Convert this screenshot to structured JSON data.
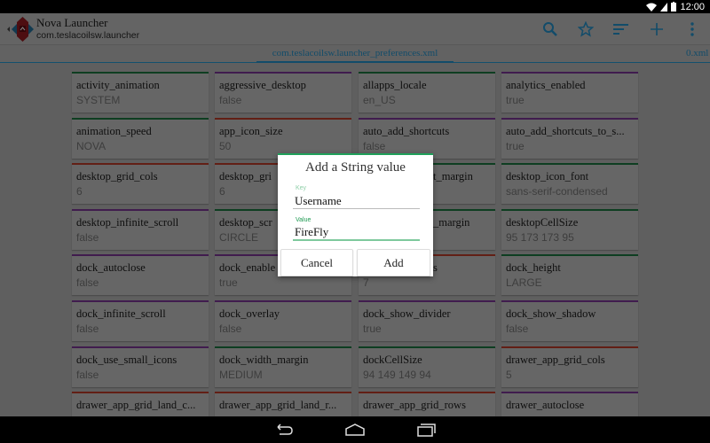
{
  "status": {
    "time": "12:00"
  },
  "app": {
    "title": "Nova Launcher",
    "package": "com.teslacoilsw.launcher"
  },
  "actions": [
    "search-icon",
    "star-icon",
    "sort-icon",
    "add-icon",
    "overflow-icon"
  ],
  "tabs": {
    "active": "com.teslacoilsw.launcher_preferences.xml",
    "next": "0.xml"
  },
  "colors": {
    "green": "#1e8a4a",
    "purple": "#8e3fae",
    "red": "#d9452f",
    "accent": "#2a90c0"
  },
  "prefs": [
    [
      {
        "name": "activity_animation",
        "value": "SYSTEM",
        "c": "green"
      },
      {
        "name": "aggressive_desktop",
        "value": "false",
        "c": "purple"
      },
      {
        "name": "allapps_locale",
        "value": "en_US",
        "c": "green"
      },
      {
        "name": "analytics_enabled",
        "value": "true",
        "c": "purple"
      }
    ],
    [
      {
        "name": "animation_speed",
        "value": "NOVA",
        "c": "green"
      },
      {
        "name": "app_icon_size",
        "value": "50",
        "c": "red"
      },
      {
        "name": "auto_add_shortcuts",
        "value": "false",
        "c": "purple"
      },
      {
        "name": "auto_add_shortcuts_to_s...",
        "value": "true",
        "c": "purple"
      }
    ],
    [
      {
        "name": "desktop_grid_cols",
        "value": "6",
        "c": "red"
      },
      {
        "name": "desktop_gri",
        "value": "6",
        "c": "red"
      },
      {
        "name": "t_margin",
        "value": "",
        "c": "green",
        "frag": true
      },
      {
        "name": "desktop_icon_font",
        "value": "sans-serif-condensed",
        "c": "green"
      }
    ],
    [
      {
        "name": "desktop_infinite_scroll",
        "value": "false",
        "c": "purple"
      },
      {
        "name": "desktop_scr",
        "value": "CIRCLE",
        "c": "green"
      },
      {
        "name": "_margin",
        "value": "",
        "c": "green",
        "frag": true
      },
      {
        "name": "desktopCellSize",
        "value": "95 173 173 95",
        "c": "green"
      }
    ],
    [
      {
        "name": "dock_autoclose",
        "value": "false",
        "c": "purple"
      },
      {
        "name": "dock_enable",
        "value": "true",
        "c": "purple"
      },
      {
        "name": "s",
        "value": "7",
        "c": "red",
        "frag": true
      },
      {
        "name": "dock_height",
        "value": "LARGE",
        "c": "green"
      }
    ],
    [
      {
        "name": "dock_infinite_scroll",
        "value": "false",
        "c": "purple"
      },
      {
        "name": "dock_overlay",
        "value": "false",
        "c": "purple"
      },
      {
        "name": "dock_show_divider",
        "value": "true",
        "c": "purple"
      },
      {
        "name": "dock_show_shadow",
        "value": "false",
        "c": "purple"
      }
    ],
    [
      {
        "name": "dock_use_small_icons",
        "value": "false",
        "c": "purple"
      },
      {
        "name": "dock_width_margin",
        "value": "MEDIUM",
        "c": "green"
      },
      {
        "name": "dockCellSize",
        "value": "94 149 149 94",
        "c": "green"
      },
      {
        "name": "drawer_app_grid_cols",
        "value": "5",
        "c": "red"
      }
    ],
    [
      {
        "name": "drawer_app_grid_land_c...",
        "value": "",
        "c": "red"
      },
      {
        "name": "drawer_app_grid_land_r...",
        "value": "",
        "c": "red"
      },
      {
        "name": "drawer_app_grid_rows",
        "value": "",
        "c": "red"
      },
      {
        "name": "drawer_autoclose",
        "value": "",
        "c": "purple"
      }
    ]
  ],
  "dialog": {
    "title": "Add a String value",
    "key_label": "Key",
    "key_value": "Username",
    "value_label": "Value",
    "value_value": "FireFly",
    "cancel": "Cancel",
    "add": "Add"
  }
}
